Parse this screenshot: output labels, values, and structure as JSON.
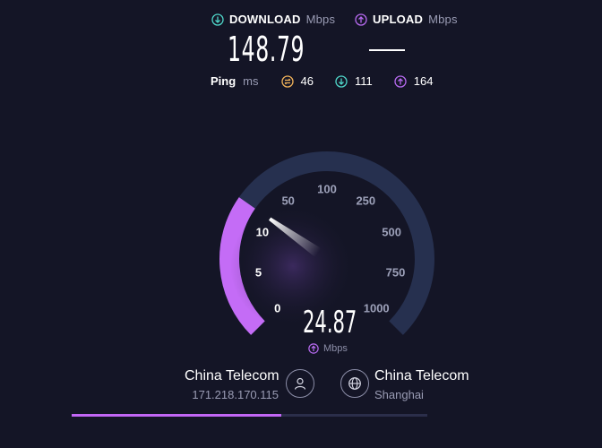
{
  "download": {
    "label": "DOWNLOAD",
    "unit": "Mbps",
    "value": "148.79",
    "icon": "arrow-down-circle-icon",
    "color": "#4fd6c9"
  },
  "upload": {
    "label": "UPLOAD",
    "unit": "Mbps",
    "value_placeholder": "—",
    "icon": "arrow-up-circle-icon",
    "color": "#b76af0"
  },
  "ping": {
    "label": "Ping",
    "unit": "ms",
    "idle": {
      "value": "46",
      "icon": "ping-idle-icon",
      "color": "#f2b35a"
    },
    "download_latency": {
      "value": "111",
      "icon": "arrow-down-circle-icon",
      "color": "#4fd6c9"
    },
    "upload_latency": {
      "value": "164",
      "icon": "arrow-up-circle-icon",
      "color": "#b76af0"
    }
  },
  "gauge": {
    "current_value": "24.87",
    "unit": "Mbps",
    "ticks": [
      "0",
      "5",
      "10",
      "50",
      "100",
      "250",
      "500",
      "750",
      "1000"
    ],
    "fill_color": "#c46cf6",
    "track_color": "#26304f"
  },
  "server_isp": {
    "name": "China Telecom",
    "ip": "171.218.170.115",
    "icon": "user-icon"
  },
  "server_host": {
    "name": "China Telecom",
    "location": "Shanghai",
    "icon": "globe-icon"
  },
  "progress": {
    "fraction": 0.59
  }
}
